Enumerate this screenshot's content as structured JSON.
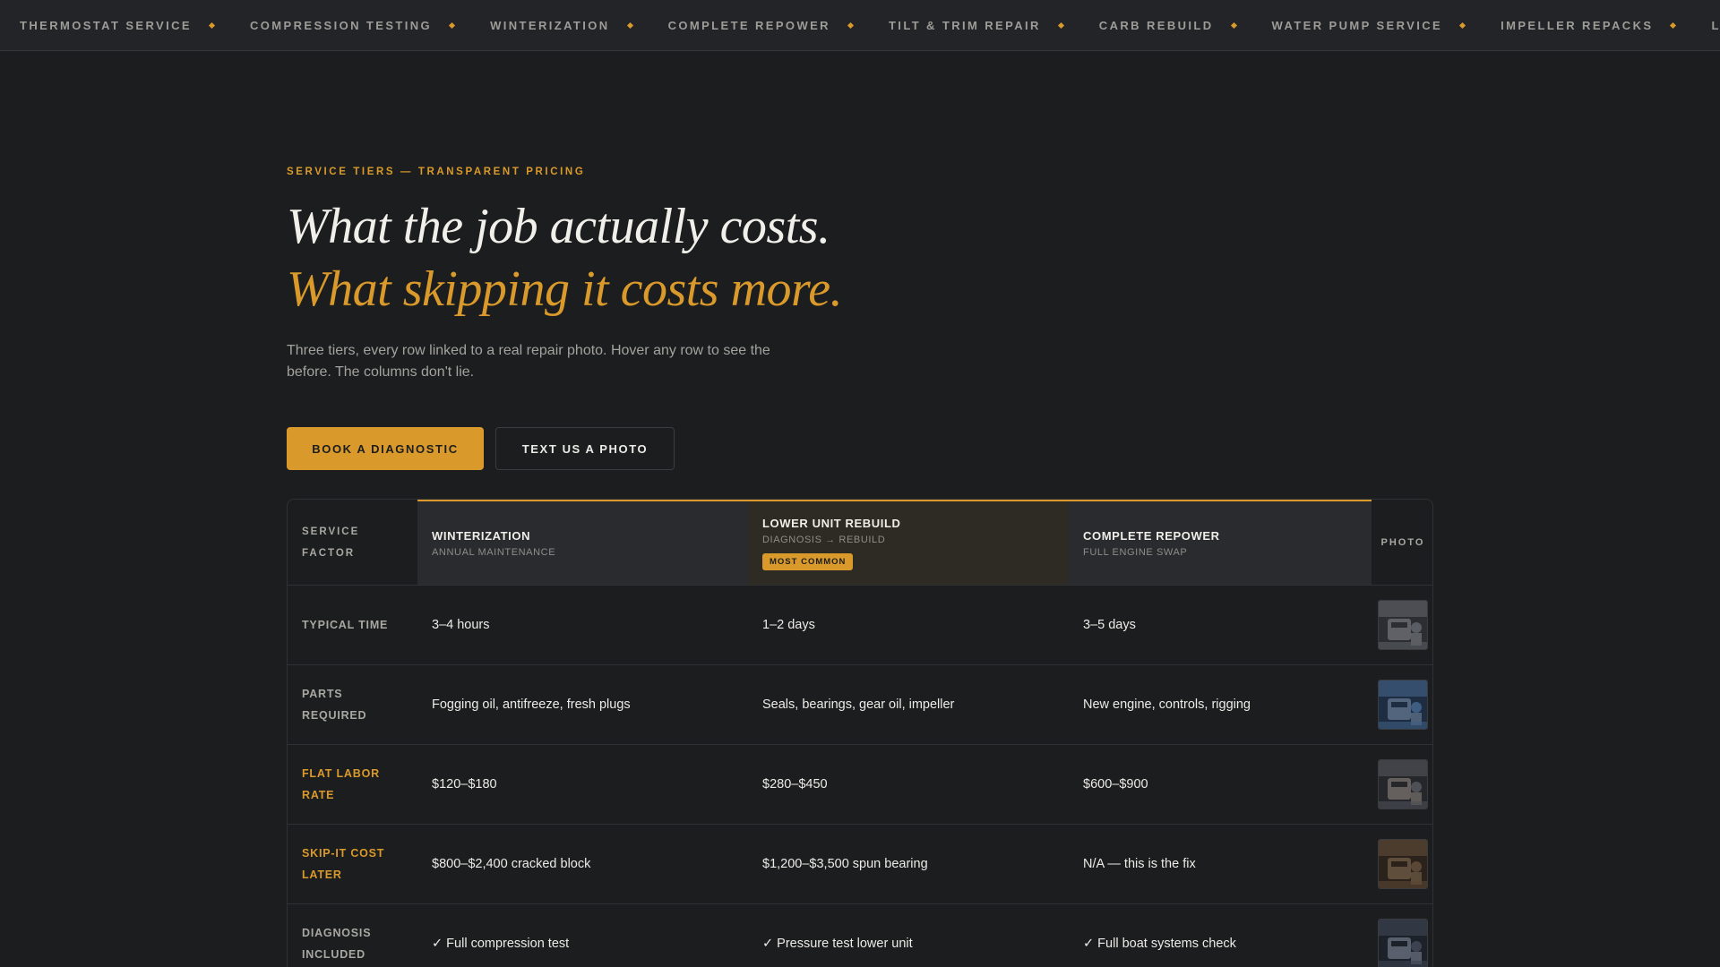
{
  "ticker": {
    "items": [
      "THERMOSTAT SERVICE",
      "COMPRESSION TESTING",
      "WINTERIZATION",
      "COMPLETE REPOWER",
      "TILT & TRIM REPAIR",
      "CARB REBUILD",
      "WATER PUMP SERVICE",
      "IMPELLER REPACKS",
      "LOWER"
    ],
    "accent_color": "#d99a2b"
  },
  "hero": {
    "eyebrow": "SERVICE TIERS — TRANSPARENT PRICING",
    "headline_line1": "What the job actually costs.",
    "headline_line2": "What skipping it costs more.",
    "lede": "Three tiers, every row linked to a real repair photo. Hover any row to see the before. The columns don't lie.",
    "primary_button": "BOOK A DIAGNOSTIC",
    "secondary_button": "TEXT US A PHOTO"
  },
  "table": {
    "factor_header": "SERVICE FACTOR",
    "photo_header": "PHOTO",
    "tiers": [
      {
        "name": "WINTERIZATION",
        "subtitle": "ANNUAL MAINTENANCE"
      },
      {
        "name": "LOWER UNIT REBUILD",
        "subtitle": "DIAGNOSIS → REBUILD",
        "badge": "MOST COMMON"
      },
      {
        "name": "COMPLETE REPOWER",
        "subtitle": "FULL ENGINE SWAP"
      }
    ],
    "rows": [
      {
        "factor": "TYPICAL TIME",
        "values": [
          "3–4 hours",
          "1–2 days",
          "3–5 days"
        ],
        "photo_icon": "engine-photo-icon"
      },
      {
        "factor": "PARTS REQUIRED",
        "values": [
          "Fogging oil, antifreeze, fresh plugs",
          "Seals, bearings, gear oil, impeller",
          "New engine, controls, rigging"
        ],
        "photo_icon": "parts-photo-icon"
      },
      {
        "factor": "FLAT LABOR RATE",
        "values": [
          "$120–$180",
          "$280–$450",
          "$600–$900"
        ],
        "photo_icon": "mechanic-photo-icon",
        "accent": true
      },
      {
        "factor": "SKIP-IT COST LATER",
        "values": [
          "$800–$2,400 cracked block",
          "$1,200–$3,500 spun bearing",
          "N/A — this is the fix"
        ],
        "photo_icon": "damage-photo-icon",
        "accent": true
      },
      {
        "factor": "DIAGNOSIS INCLUDED",
        "values": [
          "✓ Full compression test",
          "✓ Pressure test lower unit",
          "✓ Full boat systems check"
        ],
        "photo_icon": "diagnostics-photo-icon"
      }
    ]
  },
  "colors": {
    "background": "#1c1d1f",
    "accent": "#d99a2b",
    "text": "#ecebe7",
    "muted": "#a3a29e"
  }
}
